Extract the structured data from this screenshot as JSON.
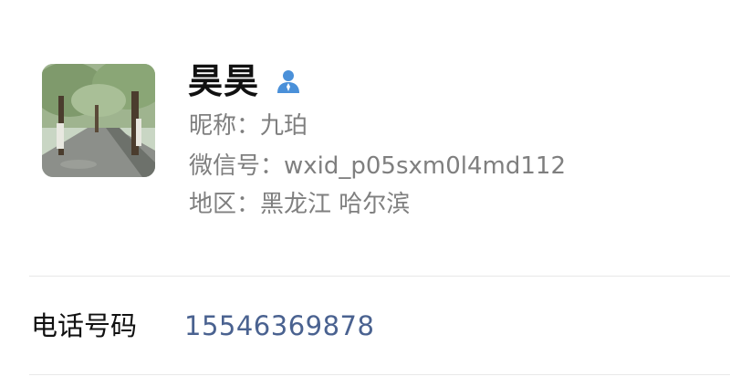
{
  "profile": {
    "display_name": "昊昊",
    "nickname_line": "昵称：九珀",
    "wechat_id_line": "微信号：wxid_p05sxm0l4md112",
    "region_line": "地区：黑龙江 哈尔滨",
    "gender_icon": "male-user-icon",
    "gender_color": "#4a90d9",
    "avatar_description_name": "avatar"
  },
  "contact": {
    "phone_label": "电话号码",
    "phone_value": "15546369878"
  },
  "colors": {
    "background": "#ffffff",
    "primary_text": "#111111",
    "secondary_text": "#7f7f7f",
    "link_text": "#4a6290",
    "divider": "#e8e8e8"
  }
}
